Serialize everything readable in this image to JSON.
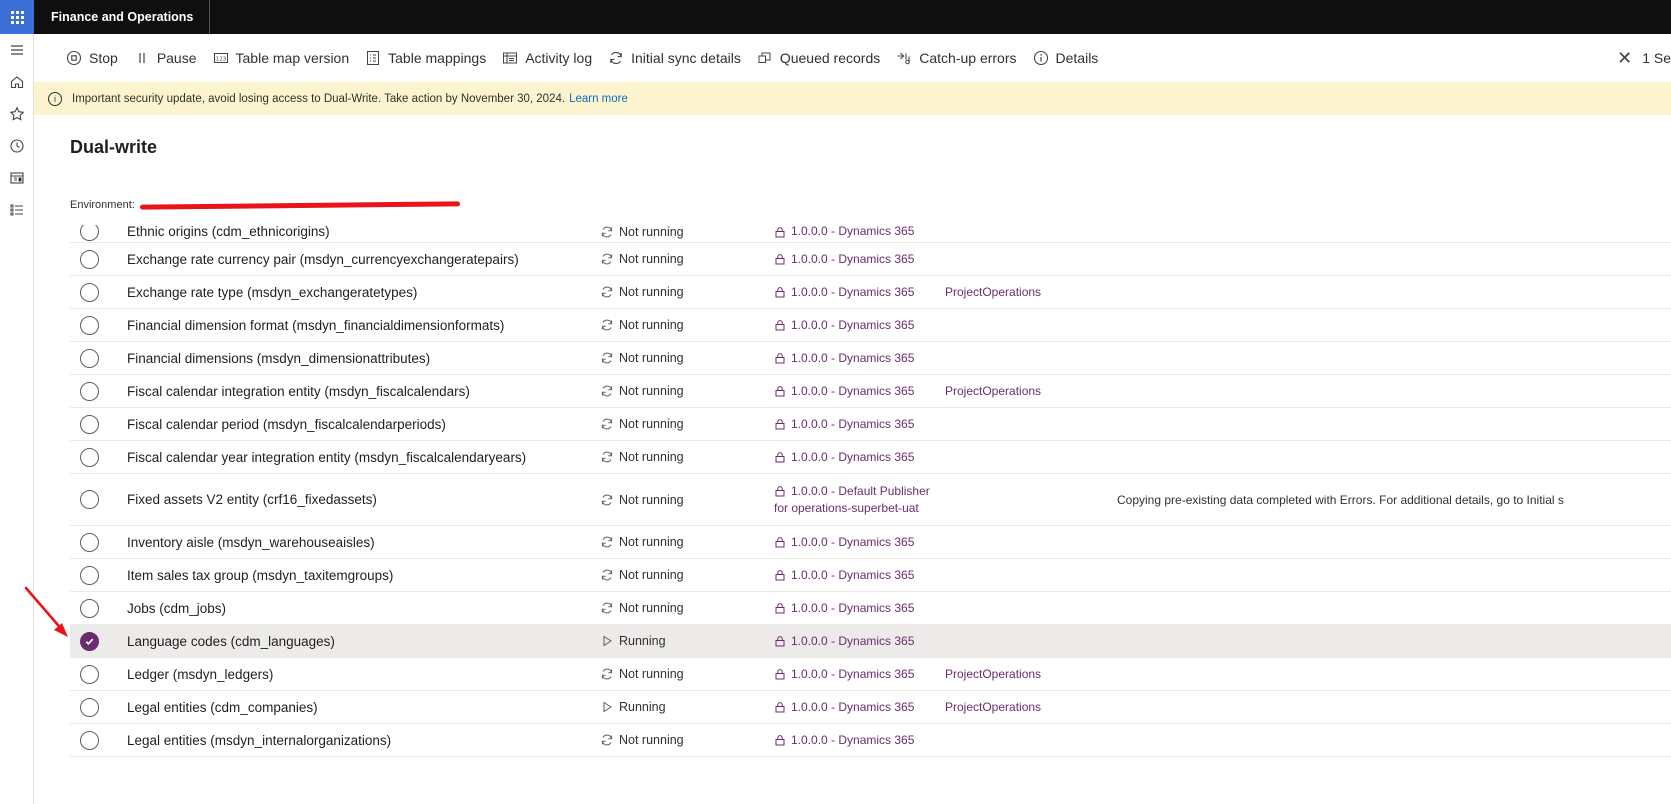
{
  "app": {
    "title": "Finance and Operations"
  },
  "commands": [
    {
      "label": "Stop",
      "icon": "stop-icon"
    },
    {
      "label": "Pause",
      "icon": "pause-icon"
    },
    {
      "label": "Table map version",
      "icon": "table-map-version-icon"
    },
    {
      "label": "Table mappings",
      "icon": "table-mappings-icon"
    },
    {
      "label": "Activity log",
      "icon": "activity-log-icon"
    },
    {
      "label": "Initial sync details",
      "icon": "sync-icon"
    },
    {
      "label": "Queued records",
      "icon": "queued-records-icon"
    },
    {
      "label": "Catch-up errors",
      "icon": "catch-up-errors-icon"
    },
    {
      "label": "Details",
      "icon": "info-icon"
    }
  ],
  "close_label": "1 Se",
  "banner": {
    "text": "Important security update, avoid losing access to Dual-Write. Take action by November 30, 2024.",
    "link": "Learn more"
  },
  "page": {
    "title": "Dual-write"
  },
  "environment": {
    "label": "Environment:"
  },
  "colors": {
    "accent": "#6b2c6f",
    "banner": "#fcf4ce",
    "topbar": "#0f0f0f",
    "waffle": "#3b6fd6",
    "arrow": "#e8141a"
  },
  "rows": [
    {
      "name": "Ethnic origins (cdm_ethnicorigins)",
      "status": "Not running",
      "version": "1.0.0.0 - Dynamics 365",
      "version2": "",
      "solution": "",
      "message": "",
      "selected": false
    },
    {
      "name": "Exchange rate currency pair (msdyn_currencyexchangeratepairs)",
      "status": "Not running",
      "version": "1.0.0.0 - Dynamics 365",
      "version2": "",
      "solution": "",
      "message": "",
      "selected": false
    },
    {
      "name": "Exchange rate type (msdyn_exchangeratetypes)",
      "status": "Not running",
      "version": "1.0.0.0 - Dynamics 365",
      "version2": "",
      "solution": "ProjectOperations",
      "message": "",
      "selected": false
    },
    {
      "name": "Financial dimension format (msdyn_financialdimensionformats)",
      "status": "Not running",
      "version": "1.0.0.0 - Dynamics 365",
      "version2": "",
      "solution": "",
      "message": "",
      "selected": false
    },
    {
      "name": "Financial dimensions (msdyn_dimensionattributes)",
      "status": "Not running",
      "version": "1.0.0.0 - Dynamics 365",
      "version2": "",
      "solution": "",
      "message": "",
      "selected": false
    },
    {
      "name": "Fiscal calendar integration entity (msdyn_fiscalcalendars)",
      "status": "Not running",
      "version": "1.0.0.0 - Dynamics 365",
      "version2": "",
      "solution": "ProjectOperations",
      "message": "",
      "selected": false
    },
    {
      "name": "Fiscal calendar period (msdyn_fiscalcalendarperiods)",
      "status": "Not running",
      "version": "1.0.0.0 - Dynamics 365",
      "version2": "",
      "solution": "",
      "message": "",
      "selected": false
    },
    {
      "name": "Fiscal calendar year integration entity (msdyn_fiscalcalendaryears)",
      "status": "Not running",
      "version": "1.0.0.0 - Dynamics 365",
      "version2": "",
      "solution": "",
      "message": "",
      "selected": false
    },
    {
      "name": "Fixed assets V2 entity (crf16_fixedassets)",
      "status": "Not running",
      "version": "1.0.0.0 - Default Publisher",
      "version2": "for operations-superbet-uat",
      "solution": "",
      "message": "Copying pre-existing data completed with Errors. For additional details, go to Initial s",
      "selected": false
    },
    {
      "name": "Inventory aisle (msdyn_warehouseaisles)",
      "status": "Not running",
      "version": "1.0.0.0 - Dynamics 365",
      "version2": "",
      "solution": "",
      "message": "",
      "selected": false
    },
    {
      "name": "Item sales tax group (msdyn_taxitemgroups)",
      "status": "Not running",
      "version": "1.0.0.0 - Dynamics 365",
      "version2": "",
      "solution": "",
      "message": "",
      "selected": false
    },
    {
      "name": "Jobs (cdm_jobs)",
      "status": "Not running",
      "version": "1.0.0.0 - Dynamics 365",
      "version2": "",
      "solution": "",
      "message": "",
      "selected": false
    },
    {
      "name": "Language codes (cdm_languages)",
      "status": "Running",
      "version": "1.0.0.0 - Dynamics 365",
      "version2": "",
      "solution": "",
      "message": "",
      "selected": true
    },
    {
      "name": "Ledger (msdyn_ledgers)",
      "status": "Not running",
      "version": "1.0.0.0 - Dynamics 365",
      "version2": "",
      "solution": "ProjectOperations",
      "message": "",
      "selected": false
    },
    {
      "name": "Legal entities (cdm_companies)",
      "status": "Running",
      "version": "1.0.0.0 - Dynamics 365",
      "version2": "",
      "solution": "ProjectOperations",
      "message": "",
      "selected": false
    },
    {
      "name": "Legal entities (msdyn_internalorganizations)",
      "status": "Not running",
      "version": "1.0.0.0 - Dynamics 365",
      "version2": "",
      "solution": "",
      "message": "",
      "selected": false
    }
  ]
}
